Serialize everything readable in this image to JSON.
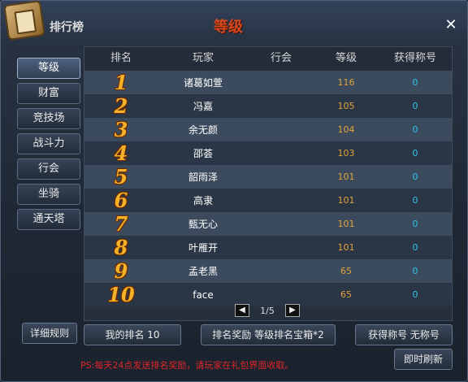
{
  "window": {
    "title": "排行榜",
    "panel_title": "等级",
    "close": "✕"
  },
  "tabs": [
    {
      "label": "等级",
      "active": true
    },
    {
      "label": "财富",
      "active": false
    },
    {
      "label": "竞技场",
      "active": false
    },
    {
      "label": "战斗力",
      "active": false
    },
    {
      "label": "行会",
      "active": false
    },
    {
      "label": "坐骑",
      "active": false
    },
    {
      "label": "通天塔",
      "active": false
    }
  ],
  "table": {
    "headers": [
      "排名",
      "玩家",
      "行会",
      "等级",
      "获得称号"
    ],
    "rows": [
      {
        "rank": "1",
        "player": "诸葛如萱",
        "guild": "",
        "level": "116",
        "title": "0"
      },
      {
        "rank": "2",
        "player": "冯嘉",
        "guild": "",
        "level": "105",
        "title": "0"
      },
      {
        "rank": "3",
        "player": "余无颜",
        "guild": "",
        "level": "104",
        "title": "0"
      },
      {
        "rank": "4",
        "player": "邵荟",
        "guild": "",
        "level": "103",
        "title": "0"
      },
      {
        "rank": "5",
        "player": "韶雨泽",
        "guild": "",
        "level": "101",
        "title": "0"
      },
      {
        "rank": "6",
        "player": "高隶",
        "guild": "",
        "level": "101",
        "title": "0"
      },
      {
        "rank": "7",
        "player": "甄无心",
        "guild": "",
        "level": "101",
        "title": "0"
      },
      {
        "rank": "8",
        "player": "叶雁开",
        "guild": "",
        "level": "101",
        "title": "0"
      },
      {
        "rank": "9",
        "player": "孟老黑",
        "guild": "",
        "level": "65",
        "title": "0"
      },
      {
        "rank": "10",
        "player": "face",
        "guild": "",
        "level": "65",
        "title": "0"
      }
    ]
  },
  "pager": {
    "prev": "◀",
    "page_text": "1/5",
    "next": "▶"
  },
  "footer": {
    "rules_button": "详细规则",
    "my_rank": "我的排名 10",
    "rank_reward": "排名奖励 等级排名宝箱*2",
    "earned_title": "获得称号 无称号",
    "refresh_button": "即时刷新",
    "notice": "PS:每天24点发送排名奖励，请玩家在礼包界面收取。"
  }
}
